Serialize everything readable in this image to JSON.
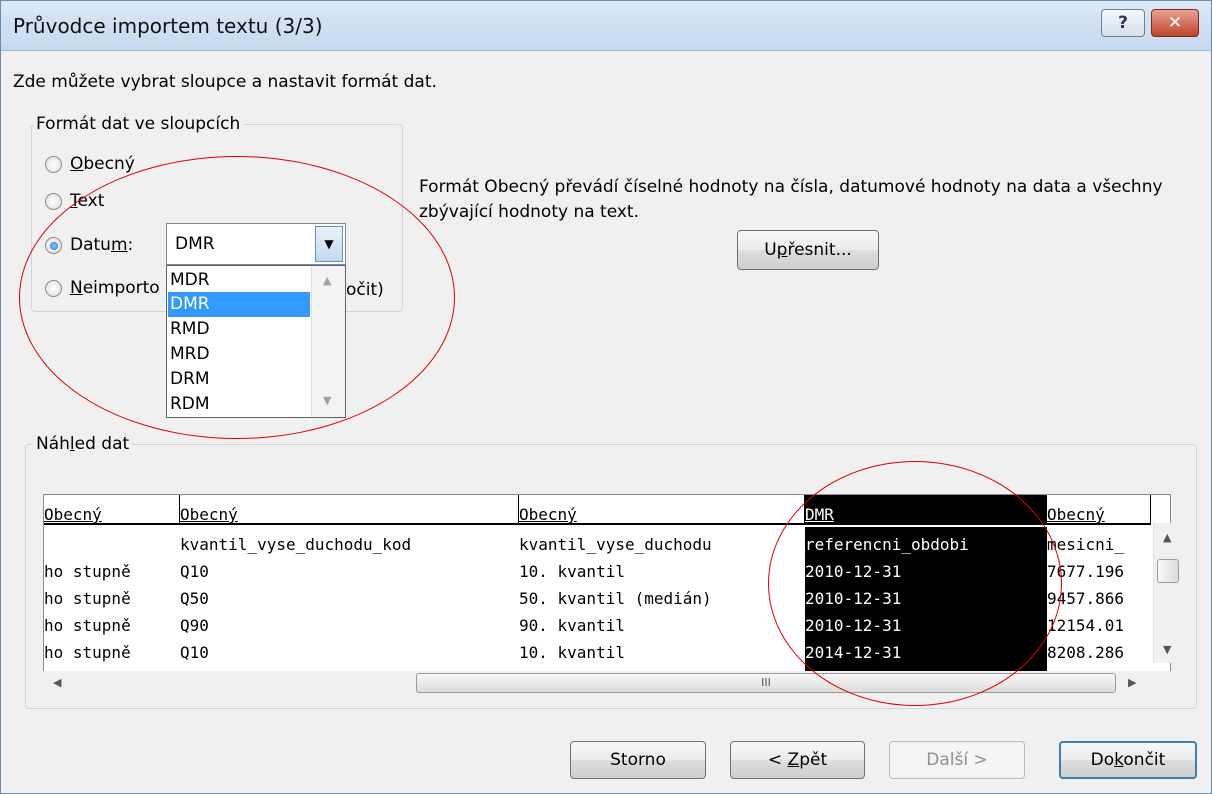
{
  "window": {
    "title": "Průvodce importem textu (3/3)",
    "help_label": "?",
    "close_label": "✕"
  },
  "intro_text": "Zde můžete vybrat sloupce a nastavit formát dat.",
  "format_group": {
    "label": "Formát dat ve sloupcích",
    "options": [
      {
        "pre": "",
        "key": "O",
        "post": "becný",
        "checked": false
      },
      {
        "pre": "",
        "key": "T",
        "post": "ext",
        "checked": false
      },
      {
        "pre": "Datu",
        "key": "m",
        "post": ":",
        "checked": true
      },
      {
        "pre": "",
        "key": "N",
        "post": "eimporto",
        "checked": false
      }
    ],
    "hidden_tail": "očit)",
    "date_combo": {
      "value": "DMR",
      "options": [
        "MDR",
        "DMR",
        "RMD",
        "MRD",
        "DRM",
        "RDM"
      ],
      "selected": "DMR"
    }
  },
  "description": "Formát Obecný převádí číselné hodnoty na čísla, datumové hodnoty na data a všechny zbývající hodnoty na text.",
  "advanced_button": {
    "pre": "U",
    "key": "p",
    "post": "řesnit..."
  },
  "preview": {
    "label_pre": "Náh",
    "label_key": "l",
    "label_post": "ed dat",
    "headers": [
      "Obecný",
      "Obecný",
      "Obecný",
      "DMR",
      "Obecný"
    ],
    "rows": [
      [
        "",
        "kvantil_vyse_duchodu_kod",
        "kvantil_vyse_duchodu",
        "referencni_obdobi",
        "mesicni_"
      ],
      [
        "ho stupně",
        "Q10",
        "10. kvantil",
        "2010-12-31",
        "7677.196"
      ],
      [
        "ho stupně",
        "Q50",
        "50. kvantil (medián)",
        "2010-12-31",
        "9457.866"
      ],
      [
        "ho stupně",
        "Q90",
        "90. kvantil",
        "2010-12-31",
        "12154.01"
      ],
      [
        "ho stupně",
        "Q10",
        "10. kvantil",
        "2014-12-31",
        "8208.286"
      ]
    ],
    "selected_column": "DMR",
    "hscroll_grip": "III"
  },
  "buttons": {
    "cancel": "Storno",
    "back": {
      "pre": "< ",
      "key": "Z",
      "post": "pět"
    },
    "next": "Další >",
    "finish": {
      "pre": "Do",
      "key": "k",
      "post": "ončit"
    }
  },
  "colors": {
    "annotation": "#e00000",
    "selection": "#3399ff"
  }
}
